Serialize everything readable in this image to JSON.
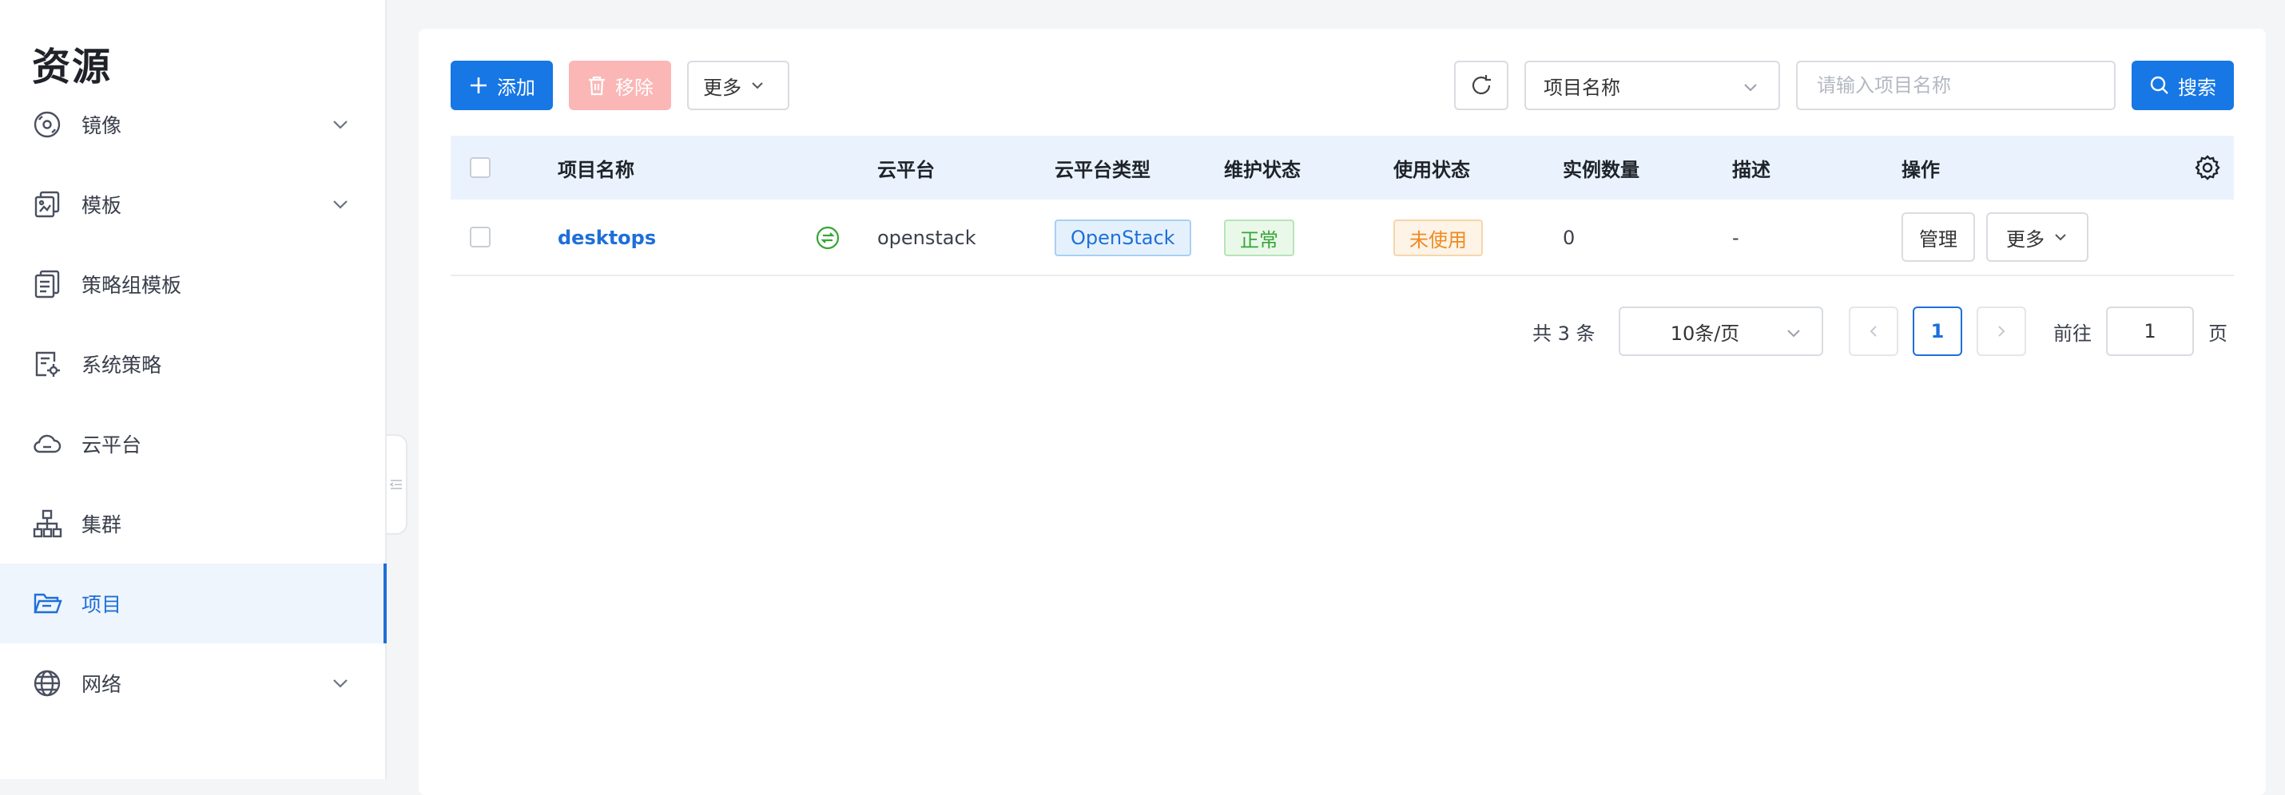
{
  "sidebar": {
    "title": "资源",
    "items": [
      {
        "label": "镜像",
        "icon": "disc-icon",
        "expandable": true
      },
      {
        "label": "模板",
        "icon": "template-icon",
        "expandable": true
      },
      {
        "label": "策略组模板",
        "icon": "policy-group-icon",
        "expandable": false
      },
      {
        "label": "系统策略",
        "icon": "system-policy-icon",
        "expandable": false
      },
      {
        "label": "云平台",
        "icon": "cloud-icon",
        "expandable": false
      },
      {
        "label": "集群",
        "icon": "cluster-icon",
        "expandable": false
      },
      {
        "label": "项目",
        "icon": "folder-icon",
        "expandable": false,
        "active": true
      },
      {
        "label": "网络",
        "icon": "globe-icon",
        "expandable": true
      }
    ]
  },
  "toolbar": {
    "add_label": "添加",
    "remove_label": "移除",
    "more_label": "更多",
    "filter_select_value": "项目名称",
    "search_placeholder": "请输入项目名称",
    "search_label": "搜索"
  },
  "table": {
    "headers": [
      "项目名称",
      "云平台",
      "云平台类型",
      "维护状态",
      "使用状态",
      "实例数量",
      "描述",
      "操作"
    ],
    "rows": [
      {
        "name": "desktops",
        "platform": "openstack",
        "platform_type": "OpenStack",
        "maintenance_status": "正常",
        "usage_status": "未使用",
        "instance_count": "0",
        "description": "-",
        "manage_label": "管理",
        "more_label": "更多"
      }
    ]
  },
  "pagination": {
    "total_text": "共 3 条",
    "page_size": "10条/页",
    "current_page": "1",
    "goto_label": "前往",
    "goto_value": "1",
    "page_suffix": "页"
  },
  "colors": {
    "primary": "#1677e5",
    "active_nav": "#1e6fd9",
    "danger_disabled": "#fbb6b6",
    "tag_green": "#36a636",
    "tag_orange": "#ef8a21",
    "header_bg": "#eaf3fd"
  }
}
